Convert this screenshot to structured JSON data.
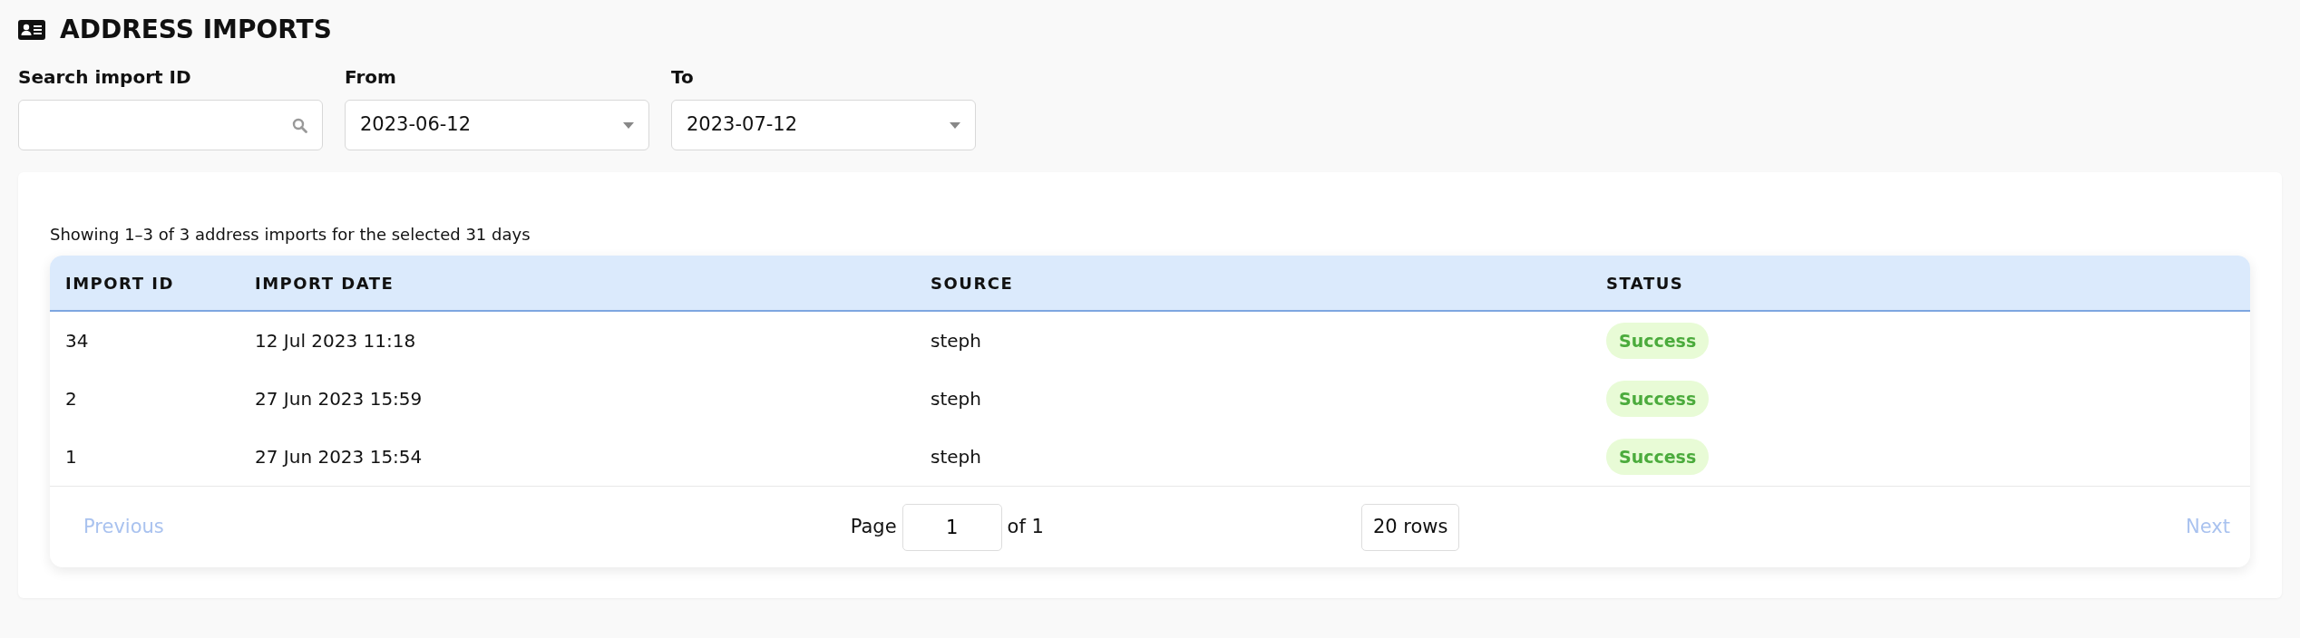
{
  "page": {
    "title": "ADDRESS IMPORTS"
  },
  "filters": [
    {
      "label": "Search import ID",
      "kind": "search"
    },
    {
      "label": "From",
      "kind": "select",
      "value": "2023-06-12"
    },
    {
      "label": "To",
      "kind": "select",
      "value": "2023-07-12"
    }
  ],
  "summary": "Showing 1–3 of 3 address imports for the selected 31 days",
  "table": {
    "columns": [
      "IMPORT ID",
      "IMPORT DATE",
      "SOURCE",
      "STATUS"
    ],
    "rows": [
      {
        "import_id": "34",
        "import_date": "12 Jul 2023 11:18",
        "source": "steph",
        "status": {
          "text": "Success",
          "kind": "success"
        }
      },
      {
        "import_id": "2",
        "import_date": "27 Jun 2023 15:59",
        "source": "steph",
        "status": {
          "text": "Success",
          "kind": "success"
        }
      },
      {
        "import_id": "1",
        "import_date": "27 Jun 2023 15:54",
        "source": "steph",
        "status": {
          "text": "Success",
          "kind": "success"
        }
      }
    ]
  },
  "pagination": {
    "previous": {
      "label": "Previous",
      "disabled": true
    },
    "page_label": "Page",
    "page_value": "1",
    "of_label": "of 1",
    "rows_value": "20 rows",
    "next": {
      "label": "Next",
      "disabled": true
    }
  }
}
